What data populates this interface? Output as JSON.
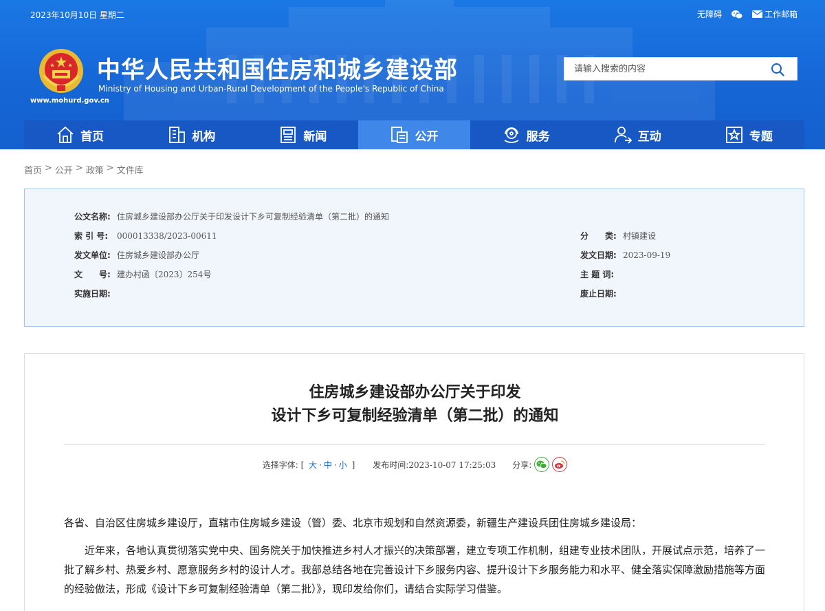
{
  "topbar": {
    "date": "2023年10月10日 星期二",
    "accessibility": "无障碍",
    "wechat_icon": "wechat-icon",
    "mail_label": "工作邮箱"
  },
  "header": {
    "title": "中华人民共和国住房和城乡建设部",
    "subtitle": "Ministry of Housing and Urban-Rural Development of the People's Republic of China",
    "url": "www.mohurd.gov.cn",
    "search_placeholder": "请输入搜索的内容"
  },
  "nav": {
    "items": [
      {
        "label": "首页",
        "icon": "home-icon"
      },
      {
        "label": "机构",
        "icon": "building-icon"
      },
      {
        "label": "新闻",
        "icon": "news-icon"
      },
      {
        "label": "公开",
        "icon": "disclosure-icon",
        "active": true
      },
      {
        "label": "服务",
        "icon": "service-icon"
      },
      {
        "label": "互动",
        "icon": "interaction-icon"
      },
      {
        "label": "专题",
        "icon": "topic-star-icon"
      }
    ]
  },
  "breadcrumb": [
    "首页",
    "公开",
    "政策",
    "文件库"
  ],
  "info": {
    "doc_name_label": "公文名称:",
    "doc_name": "住房城乡建设部办公厅关于印发设计下乡可复制经验清单（第二批）的通知",
    "index_label": "索 引 号:",
    "index": "000013338/2023-00611",
    "category_label": "分　　类:",
    "category": "村镇建设",
    "issuer_label": "发文单位:",
    "issuer": "住房城乡建设部办公厅",
    "issue_date_label": "发文日期:",
    "issue_date": "2023-09-19",
    "doc_no_label": "文　　号:",
    "doc_no": "建办村函〔2023〕254号",
    "keywords_label": "主 题 词:",
    "keywords": "",
    "effective_label": "实施日期:",
    "effective": "",
    "expire_label": "废止日期:",
    "expire": ""
  },
  "article": {
    "title_line1": "住房城乡建设部办公厅关于印发",
    "title_line2": "设计下乡可复制经验清单（第二批）的通知",
    "font_label": "选择字体:",
    "font_open": "[",
    "font_large": "大",
    "font_medium": "中",
    "font_small": "小",
    "font_sep": "·",
    "font_close": "]",
    "publish_label": "发布时间:",
    "publish_time": "2023-10-07 17:25:03",
    "share_label": "分享:",
    "paragraphs": [
      "各省、自治区住房城乡建设厅，直辖市住房城乡建设（管）委、北京市规划和自然资源委，新疆生产建设兵团住房城乡建设局：",
      "近年来，各地认真贯彻落实党中央、国务院关于加快推进乡村人才振兴的决策部署，建立专项工作机制，组建专业技术团队，开展试点示范，培养了一批了解乡村、热爱乡村、愿意服务乡村的设计人才。我部总结各地在完善设计下乡服务内容、提升设计下乡服务能力和水平、健全落实保障激励措施等方面的经验做法，形成《设计下乡可复制经验清单（第二批）》，现印发给你们，请结合实际学习借鉴。"
    ]
  },
  "colors": {
    "header_blue": "#1666d6",
    "nav_blue": "#1758c4",
    "nav_active": "#3f88ea",
    "link_blue": "#1a6ad4",
    "info_bg": "#f1f6fc",
    "info_border": "#a8c6ea"
  }
}
